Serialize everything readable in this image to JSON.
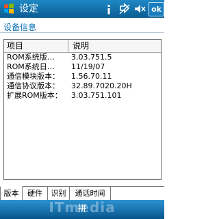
{
  "titlebar": {
    "title": "设定",
    "ok_label": "ok",
    "icons": [
      "windows-start-icon",
      "info-icon",
      "connectivity-icon",
      "volume-icon"
    ]
  },
  "page": {
    "heading": "设备信息"
  },
  "table": {
    "columns": [
      "项目",
      "说明"
    ],
    "rows": [
      {
        "name": "ROM系统版…",
        "value": "3.03.751.5"
      },
      {
        "name": "ROM系统日…",
        "value": "11/19/07"
      },
      {
        "name": "通信模块版本：",
        "value": "1.56.70.11"
      },
      {
        "name": "通信协议版本：",
        "value": "32.89.7020.20H"
      },
      {
        "name": "扩展ROM版本：",
        "value": "3.03.751.101"
      }
    ]
  },
  "tabs": [
    "版本",
    "硬件",
    "识别",
    "通话时间"
  ],
  "softkeys": {
    "input_label": "拼"
  },
  "watermark": "ITmedia",
  "colors": {
    "titlebar": "#0a5c93",
    "heading": "#0a73b5",
    "softbar": "#1a75b4"
  }
}
